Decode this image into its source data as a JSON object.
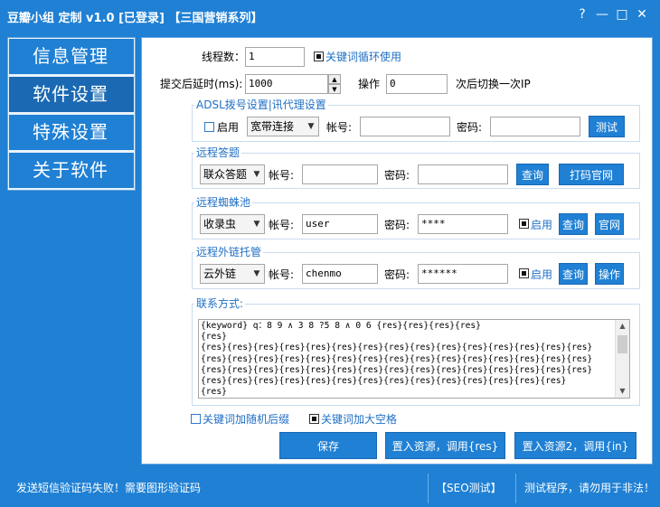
{
  "window": {
    "title": "豆瓣小组 定制 v1.0 [已登录]  【三国营销系列】",
    "help_glyph": "?",
    "minimize_glyph": "—",
    "maximize_glyph": "□",
    "close_glyph": "✕"
  },
  "nav": {
    "items": [
      {
        "label": "信息管理"
      },
      {
        "label": "软件设置"
      },
      {
        "label": "特殊设置"
      },
      {
        "label": "关于软件"
      }
    ]
  },
  "settings": {
    "thread_label": "线程数：",
    "thread_value": "1",
    "loop_keywords_label": "关键词循环使用",
    "delay_label": "提交后延时(ms):",
    "delay_value": "1000",
    "op_label": "操作",
    "op_value": "0",
    "switch_ip_label": "次后切换一次IP"
  },
  "adsl": {
    "title": "ADSL拨号设置|讯代理设置",
    "enable_label": "启用",
    "mode_value": "宽带连接",
    "account_label": "帐号:",
    "password_label": "密码:",
    "test_button": "测试"
  },
  "captcha": {
    "title": "远程答题",
    "service_value": "联众答题",
    "account_label": "帐号:",
    "password_label": "密码:",
    "query_button": "查询",
    "site_button": "打码官网"
  },
  "spider": {
    "title": "远程蜘蛛池",
    "service_value": "收录虫",
    "account_label": "帐号:",
    "account_value": "user",
    "password_label": "密码:",
    "password_value": "****",
    "enable_label": "启用",
    "query_button": "查询",
    "site_button": "官网"
  },
  "links": {
    "title": "远程外链托管",
    "service_value": "云外链",
    "account_label": "帐号:",
    "account_value": "chenmo",
    "password_label": "密码:",
    "password_value": "******",
    "enable_label": "启用",
    "query_button": "查询",
    "op_button": "操作"
  },
  "contact": {
    "title": "联系方式:",
    "text": "{keyword} q：8 9 ∧ 3 8 ?5 8 ∧ 0 6 {res}{res}{res}{res}\n{res}\n{res}{res}{res}{res}{res}{res}{res}{res}{res}{res}{res}{res}{res}{res}{res}\n{res}{res}{res}{res}{res}{res}{res}{res}{res}{res}{res}{res}{res}{res}{res}\n{res}{res}{res}{res}{res}{res}{res}{res}{res}{res}{res}{res}{res}{res}{res}\n{res}{res}{res}{res}{res}{res}{res}{res}{res}{res}{res}{res}{res}{res}\n{res}"
  },
  "options": {
    "random_suffix_label": "关键词加随机后缀",
    "add_space_label": "关键词加大空格"
  },
  "actions": {
    "save_button": "保存",
    "import1_button": "置入资源，调用{res}",
    "import2_button": "置入资源2，调用{in}"
  },
  "status": {
    "message": "发送短信验证码失败！需要图形验证码",
    "seo_test": "【SEO测试】",
    "notice": "测试程序，请勿用于非法！"
  }
}
